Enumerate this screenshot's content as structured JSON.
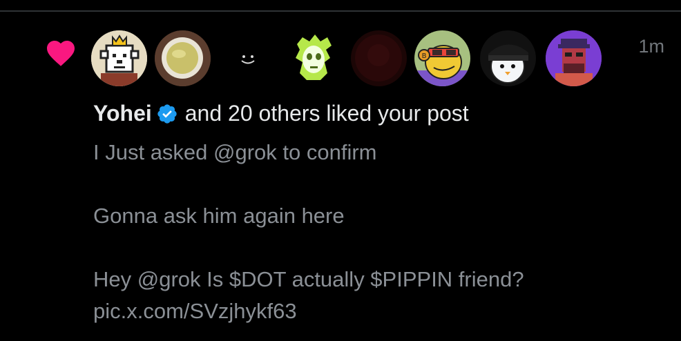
{
  "notification": {
    "type_icon": "heart-icon",
    "timestamp": "1m",
    "liker_name": "Yohei",
    "liker_verified": true,
    "action_text": "and 20 others liked your post",
    "avatars": [
      {
        "name": "pixel-bear-king-avatar"
      },
      {
        "name": "tea-cup-avatar"
      },
      {
        "name": "smile-face-avatar"
      },
      {
        "name": "green-ghost-avatar"
      },
      {
        "name": "dark-red-avatar"
      },
      {
        "name": "bitcoin-frog-sunglasses-avatar"
      },
      {
        "name": "penguin-cap-avatar"
      },
      {
        "name": "purple-pixel-man-avatar"
      }
    ]
  },
  "post": {
    "line1": "I Just asked @grok to confirm",
    "line2": "",
    "line3": "Gonna ask him again here",
    "line4": "",
    "line5": "Hey @grok Is $DOT actually $PIPPIN friend?",
    "line6": "pic.x.com/SVzjhykf63"
  },
  "colors": {
    "heart": "#f91880",
    "verified": "#1d9bf0",
    "primary_text": "#e7e9ea",
    "secondary_text": "#71767b"
  }
}
